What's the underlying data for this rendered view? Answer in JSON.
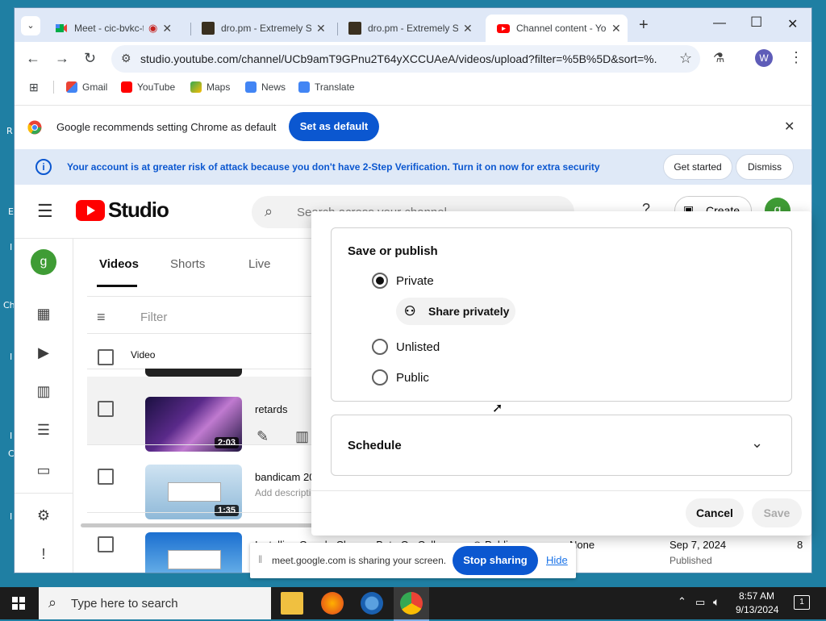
{
  "browser": {
    "tabs": [
      {
        "title": "Meet - cic-bvkc-t",
        "active": false
      },
      {
        "title": "dro.pm - Extremely S",
        "active": false
      },
      {
        "title": "dro.pm - Extremely S",
        "active": false
      },
      {
        "title": "Channel content - Yo",
        "active": true
      }
    ],
    "url": "studio.youtube.com/channel/UCb9amT9GPnu2T64yXCCUAeA/videos/upload?filter=%5B%5D&sort=%...",
    "profile_initial": "W",
    "bookmarks": [
      "Gmail",
      "YouTube",
      "Maps",
      "News",
      "Translate"
    ],
    "default_bar": {
      "text": "Google recommends setting Chrome as default",
      "button": "Set as default"
    },
    "security_bar": {
      "text": "Your account is at greater risk of attack because you don't have 2-Step Verification. Turn it on now for extra security",
      "get_started": "Get started",
      "dismiss": "Dismiss"
    }
  },
  "studio": {
    "logo_text": "Studio",
    "search_placeholder": "Search across your channel",
    "create_label": "Create",
    "avatar_initial": "g",
    "tabs": [
      "Videos",
      "Shorts",
      "Live"
    ],
    "filter_label": "Filter",
    "col_video": "Video",
    "rows": [
      {
        "title": "retards",
        "desc": "",
        "duration": "2:03"
      },
      {
        "title": "bandicam 2024",
        "desc": "Add description",
        "duration": "1:35"
      },
      {
        "title": "Installing Google Chrome Beta On Coll...",
        "desc": "",
        "visibility": "Public",
        "restrictions": "None",
        "date": "Sep 7, 2024",
        "status": "Published",
        "views": "8"
      }
    ]
  },
  "dialog": {
    "section_title": "Save or publish",
    "options": [
      "Private",
      "Unlisted",
      "Public"
    ],
    "selected": "Private",
    "share_privately": "Share privately",
    "schedule": "Schedule",
    "cancel": "Cancel",
    "save": "Save"
  },
  "sharebar": {
    "text": "meet.google.com is sharing your screen.",
    "stop": "Stop sharing",
    "hide": "Hide"
  },
  "taskbar": {
    "search_placeholder": "Type here to search",
    "time": "8:57 AM",
    "date": "9/13/2024",
    "notif_count": "1"
  },
  "desktop_fragments": [
    "R",
    "E",
    "I",
    "Ch",
    "I",
    "I",
    "C",
    "I"
  ]
}
